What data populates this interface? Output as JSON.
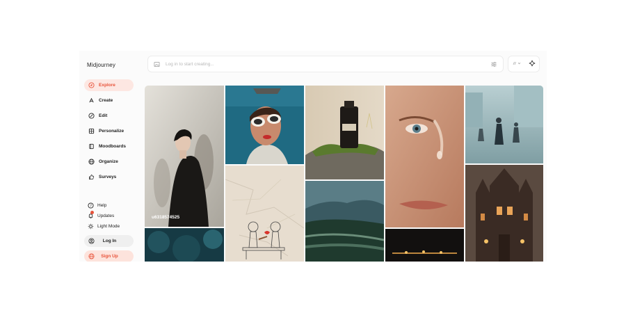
{
  "app": {
    "title": "Midjourney"
  },
  "nav": [
    {
      "label": "Explore",
      "icon": "compass-icon",
      "active": true
    },
    {
      "label": "Create",
      "icon": "brush-icon",
      "active": false
    },
    {
      "label": "Edit",
      "icon": "edit-icon",
      "active": false
    },
    {
      "label": "Personalize",
      "icon": "palette-icon",
      "active": false
    },
    {
      "label": "Moodboards",
      "icon": "moodboard-icon",
      "active": false
    },
    {
      "label": "Organize",
      "icon": "globe-icon",
      "active": false
    },
    {
      "label": "Surveys",
      "icon": "thumbs-up-icon",
      "active": false
    }
  ],
  "utility": {
    "help": "Help",
    "updates": "Updates",
    "theme": "Light Mode"
  },
  "auth": {
    "login": "Log In",
    "signup": "Sign Up"
  },
  "search": {
    "placeholder": "Log in to start creating..."
  },
  "gallery": {
    "featured_user": "u6318574525"
  },
  "colors": {
    "accent": "#e8533a",
    "accent_bg": "#fde7e2"
  }
}
